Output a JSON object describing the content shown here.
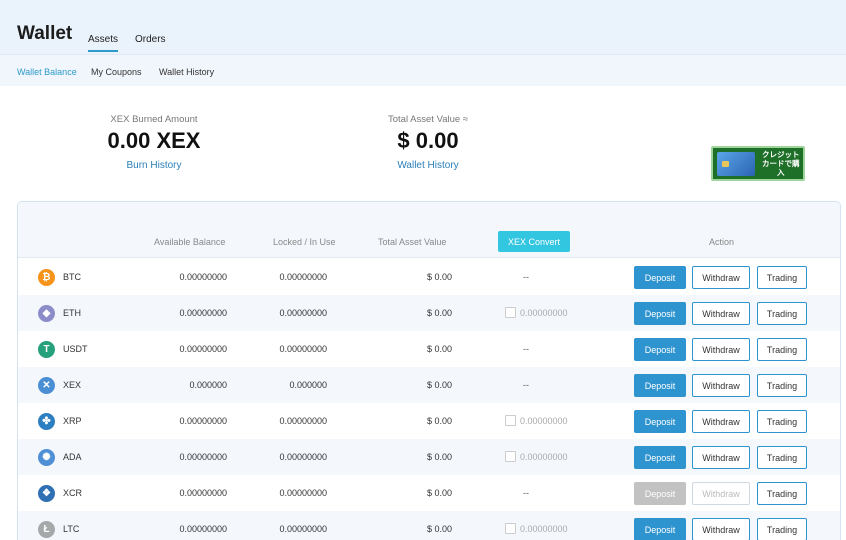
{
  "header": {
    "title": "Wallet",
    "tabs": [
      {
        "label": "Assets",
        "active": true
      },
      {
        "label": "Orders",
        "active": false
      }
    ]
  },
  "subnav": {
    "items": [
      {
        "label": "Wallet Balance",
        "active": true
      },
      {
        "label": "My Coupons",
        "active": false
      },
      {
        "label": "Wallet History",
        "active": false
      }
    ]
  },
  "summary": {
    "burned": {
      "label": "XEX Burned Amount",
      "value": "0.00 XEX",
      "link": "Burn History"
    },
    "total": {
      "label": "Total Asset Value ≈",
      "value": "$ 0.00",
      "link": "Wallet History"
    }
  },
  "banner": {
    "line1": "クレジット",
    "line2": "カードで購入",
    "card_text": "CREDIT CARD"
  },
  "table": {
    "headers": {
      "available": "Available Balance",
      "locked": "Locked / In Use",
      "total": "Total Asset Value",
      "convert": "XEX Convert",
      "action": "Action"
    },
    "actions": {
      "deposit": "Deposit",
      "withdraw": "Withdraw",
      "trading": "Trading"
    },
    "rows": [
      {
        "symbol": "BTC",
        "available": "0.00000000",
        "locked": "0.00000000",
        "total": "$ 0.00",
        "convert": "--",
        "convertible": false,
        "icon": "bitcoin-icon",
        "color": "#f7931a",
        "glyph": "₿",
        "disabled": false
      },
      {
        "symbol": "ETH",
        "available": "0.00000000",
        "locked": "0.00000000",
        "total": "$ 0.00",
        "convert": "0.00000000",
        "convertible": true,
        "icon": "ethereum-icon",
        "color": "#8c8cc9",
        "glyph": "◆",
        "disabled": false
      },
      {
        "symbol": "USDT",
        "available": "0.00000000",
        "locked": "0.00000000",
        "total": "$ 0.00",
        "convert": "--",
        "convertible": false,
        "icon": "tether-icon",
        "color": "#26a17b",
        "glyph": "T",
        "disabled": false
      },
      {
        "symbol": "XEX",
        "available": "0.000000",
        "locked": "0.000000",
        "total": "$ 0.00",
        "convert": "--",
        "convertible": false,
        "icon": "xex-icon",
        "color": "#4a8fd4",
        "glyph": "✕",
        "disabled": false
      },
      {
        "symbol": "XRP",
        "available": "0.00000000",
        "locked": "0.00000000",
        "total": "$ 0.00",
        "convert": "0.00000000",
        "convertible": true,
        "icon": "ripple-icon",
        "color": "#2d7fc1",
        "glyph": "✤",
        "disabled": false
      },
      {
        "symbol": "ADA",
        "available": "0.00000000",
        "locked": "0.00000000",
        "total": "$ 0.00",
        "convert": "0.00000000",
        "convertible": true,
        "icon": "cardano-icon",
        "color": "#4f8fd6",
        "glyph": "✺",
        "disabled": false
      },
      {
        "symbol": "XCR",
        "available": "0.00000000",
        "locked": "0.00000000",
        "total": "$ 0.00",
        "convert": "--",
        "convertible": false,
        "icon": "crypto-com-icon",
        "color": "#2f6fb3",
        "glyph": "❖",
        "disabled": true
      },
      {
        "symbol": "LTC",
        "available": "0.00000000",
        "locked": "0.00000000",
        "total": "$ 0.00",
        "convert": "0.00000000",
        "convertible": true,
        "icon": "litecoin-icon",
        "color": "#a6a9aa",
        "glyph": "Ł",
        "disabled": false
      }
    ]
  }
}
